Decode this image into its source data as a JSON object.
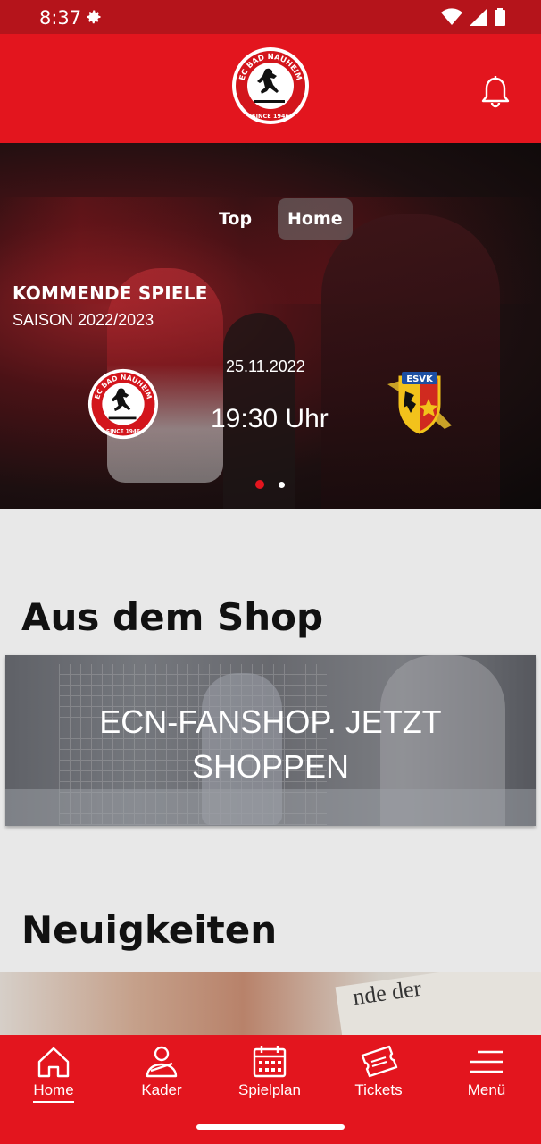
{
  "status_bar": {
    "time": "8:37",
    "icons": [
      "gear-icon",
      "wifi-icon",
      "signal-icon",
      "battery-icon"
    ]
  },
  "header": {
    "logo": "EC BAD NAUHEIM",
    "logo_subtext": "SINCE 1946",
    "bell_icon": "bell-icon",
    "brand_color": "#e3151e"
  },
  "hero": {
    "toggle_top": "Top",
    "toggle_home": "Home",
    "title": "KOMMENDE SPIELE",
    "season": "SAISON 2022/2023",
    "game": {
      "date": "25.11.2022",
      "time": "19:30 Uhr",
      "home_team": "EC BAD NAUHEIM",
      "home_team_sub": "SINCE 1946",
      "away_team": "ESVK"
    },
    "carousel_index": 1,
    "carousel_count": 2
  },
  "shop": {
    "section_title": "Aus dem Shop",
    "banner_line1": "ECN-FANSHOP. JETZT",
    "banner_line2": "SHOPPEN"
  },
  "news": {
    "section_title": "Neuigkeiten",
    "image_text": "nde der"
  },
  "bottom_nav": [
    {
      "label": "Home",
      "icon": "home-icon",
      "active": true
    },
    {
      "label": "Kader",
      "icon": "team-icon",
      "active": false
    },
    {
      "label": "Spielplan",
      "icon": "calendar-icon",
      "active": false
    },
    {
      "label": "Tickets",
      "icon": "ticket-icon",
      "active": false
    },
    {
      "label": "Menü",
      "icon": "menu-icon",
      "active": false
    }
  ]
}
